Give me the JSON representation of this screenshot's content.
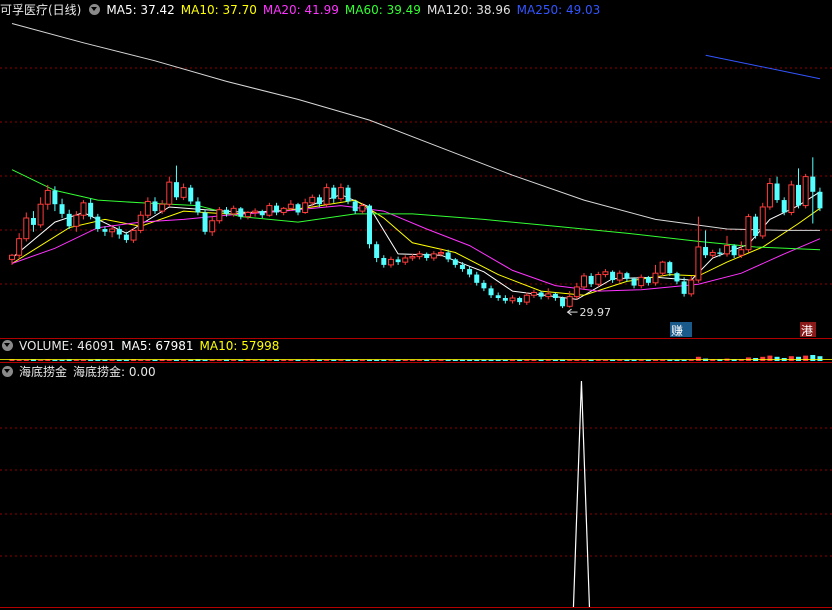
{
  "header": {
    "title": "可孚医疗(日线)",
    "ma": [
      {
        "label": "MA5: 37.42",
        "color": "#ffffff"
      },
      {
        "label": "MA10: 37.70",
        "color": "#ffff00"
      },
      {
        "label": "MA20: 41.99",
        "color": "#ff33ff"
      },
      {
        "label": "MA60: 39.49",
        "color": "#33ff33"
      },
      {
        "label": "MA120: 38.96",
        "color": "#e0e0e0"
      },
      {
        "label": "MA250: 49.03",
        "color": "#3355ff"
      }
    ]
  },
  "volume_panel": {
    "title": "VOLUME: 46091",
    "ma5": "MA5: 67981",
    "ma10": "MA10: 57998"
  },
  "indicator_panel": {
    "title": "海底捞金",
    "value_label": "海底捞金: 0.00"
  },
  "colors": {
    "up": "#ff3c3c",
    "down": "#54ffff",
    "ma5": "#ffffff",
    "ma10": "#ffff00",
    "ma20": "#ff33ff",
    "ma60": "#33ff33",
    "ma120": "#d8d8d8",
    "ma250": "#3355ff",
    "grid": "#8b0000"
  },
  "chart_data": {
    "type": "candlestick",
    "y_range": [
      27.8,
      51.0
    ],
    "low_annotation": "29.97",
    "signal_labels": [
      "赚",
      "港"
    ],
    "candles": [
      [
        33.5,
        33.8,
        33.1,
        33.9
      ],
      [
        33.8,
        35.0,
        33.5,
        35.4
      ],
      [
        35.0,
        36.5,
        34.8,
        36.9
      ],
      [
        36.5,
        36.0,
        35.5,
        37.0
      ],
      [
        36.0,
        37.5,
        35.8,
        38.0
      ],
      [
        37.5,
        38.5,
        37.1,
        38.9
      ],
      [
        38.5,
        37.5,
        37.0,
        38.8
      ],
      [
        37.5,
        36.8,
        36.5,
        37.9
      ],
      [
        36.8,
        35.9,
        35.7,
        37.1
      ],
      [
        35.9,
        36.7,
        35.5,
        37.0
      ],
      [
        36.7,
        37.6,
        36.4,
        37.8
      ],
      [
        37.6,
        36.6,
        36.4,
        37.9
      ],
      [
        36.6,
        35.7,
        35.5,
        36.8
      ],
      [
        35.7,
        35.5,
        35.2,
        35.9
      ],
      [
        35.5,
        35.7,
        35.1,
        36.0
      ],
      [
        35.7,
        35.3,
        35.0,
        35.9
      ],
      [
        35.3,
        34.9,
        34.7,
        35.5
      ],
      [
        34.9,
        35.6,
        34.7,
        35.8
      ],
      [
        35.6,
        36.7,
        35.4,
        37.0
      ],
      [
        36.7,
        37.7,
        36.5,
        38.0
      ],
      [
        37.7,
        37.0,
        36.8,
        38.0
      ],
      [
        37.0,
        37.5,
        36.8,
        37.8
      ],
      [
        37.5,
        39.1,
        37.3,
        39.5
      ],
      [
        39.1,
        38.0,
        37.8,
        40.3
      ],
      [
        38.0,
        38.7,
        37.8,
        39.0
      ],
      [
        38.7,
        37.7,
        37.5,
        38.9
      ],
      [
        37.7,
        36.9,
        36.7,
        38.0
      ],
      [
        36.9,
        35.5,
        35.3,
        37.1
      ],
      [
        35.5,
        36.3,
        35.2,
        36.6
      ],
      [
        36.3,
        37.1,
        36.1,
        37.3
      ],
      [
        37.1,
        36.8,
        36.6,
        37.3
      ],
      [
        36.8,
        37.2,
        36.6,
        37.4
      ],
      [
        37.2,
        36.6,
        36.4,
        37.3
      ],
      [
        36.6,
        36.9,
        36.4,
        37.0
      ],
      [
        36.9,
        37.0,
        36.6,
        37.2
      ],
      [
        37.0,
        36.7,
        36.5,
        37.1
      ],
      [
        36.7,
        37.4,
        36.6,
        37.6
      ],
      [
        37.4,
        36.9,
        36.7,
        37.6
      ],
      [
        36.9,
        37.2,
        36.7,
        37.3
      ],
      [
        37.2,
        37.5,
        37.0,
        37.8
      ],
      [
        37.5,
        36.9,
        36.7,
        37.6
      ],
      [
        36.9,
        37.6,
        36.8,
        37.9
      ],
      [
        37.6,
        38.0,
        37.3,
        38.2
      ],
      [
        38.0,
        37.5,
        37.3,
        38.2
      ],
      [
        37.5,
        38.7,
        37.3,
        39.0
      ],
      [
        38.7,
        37.9,
        37.6,
        38.9
      ],
      [
        37.9,
        38.7,
        37.7,
        39.0
      ],
      [
        38.7,
        37.7,
        37.5,
        38.9
      ],
      [
        37.7,
        37.0,
        36.8,
        37.8
      ],
      [
        37.0,
        37.4,
        36.8,
        37.6
      ],
      [
        37.4,
        34.6,
        34.3,
        37.5
      ],
      [
        34.6,
        33.6,
        33.3,
        34.8
      ],
      [
        33.6,
        33.1,
        32.9,
        33.8
      ],
      [
        33.1,
        33.5,
        32.9,
        33.7
      ],
      [
        33.5,
        33.3,
        33.1,
        33.7
      ],
      [
        33.3,
        33.6,
        33.1,
        33.8
      ],
      [
        33.6,
        33.7,
        33.4,
        33.9
      ],
      [
        33.7,
        33.9,
        33.5,
        34.1
      ],
      [
        33.9,
        33.6,
        33.4,
        34.0
      ],
      [
        33.6,
        33.9,
        33.4,
        34.1
      ],
      [
        33.9,
        34.0,
        33.7,
        34.3
      ],
      [
        34.0,
        33.5,
        33.3,
        34.2
      ],
      [
        33.5,
        33.1,
        32.9,
        33.6
      ],
      [
        33.1,
        32.8,
        32.6,
        33.3
      ],
      [
        32.8,
        32.4,
        32.2,
        33.0
      ],
      [
        32.4,
        31.8,
        31.6,
        32.6
      ],
      [
        31.8,
        31.4,
        31.2,
        32.0
      ],
      [
        31.4,
        30.9,
        30.7,
        31.6
      ],
      [
        30.9,
        30.7,
        30.5,
        31.1
      ],
      [
        30.7,
        30.5,
        30.3,
        30.9
      ],
      [
        30.5,
        30.7,
        30.3,
        30.9
      ],
      [
        30.7,
        30.4,
        30.2,
        30.8
      ],
      [
        30.4,
        30.9,
        30.2,
        31.1
      ],
      [
        30.9,
        31.1,
        30.7,
        31.3
      ],
      [
        31.1,
        30.8,
        30.6,
        31.2
      ],
      [
        30.8,
        31.0,
        30.6,
        31.4
      ],
      [
        31.0,
        30.7,
        30.5,
        31.1
      ],
      [
        30.7,
        30.1,
        29.97,
        30.8
      ],
      [
        30.1,
        30.8,
        30.0,
        31.2
      ],
      [
        30.8,
        31.5,
        30.6,
        31.8
      ],
      [
        31.5,
        32.3,
        31.3,
        32.5
      ],
      [
        32.3,
        31.7,
        31.5,
        32.5
      ],
      [
        31.7,
        32.4,
        31.5,
        32.6
      ],
      [
        32.4,
        32.6,
        32.2,
        32.8
      ],
      [
        32.6,
        32.0,
        31.8,
        32.7
      ],
      [
        32.0,
        32.5,
        31.8,
        32.7
      ],
      [
        32.5,
        32.1,
        31.9,
        32.6
      ],
      [
        32.1,
        31.6,
        31.4,
        32.2
      ],
      [
        31.6,
        32.2,
        31.4,
        32.4
      ],
      [
        32.2,
        31.8,
        31.6,
        32.3
      ],
      [
        31.8,
        32.5,
        31.6,
        33.1
      ],
      [
        32.5,
        33.3,
        32.3,
        33.4
      ],
      [
        33.3,
        32.5,
        32.3,
        33.4
      ],
      [
        32.5,
        31.9,
        31.7,
        32.6
      ],
      [
        31.9,
        31.0,
        30.8,
        32.2
      ],
      [
        31.0,
        32.0,
        30.8,
        32.3
      ],
      [
        32.0,
        34.4,
        31.8,
        36.6
      ],
      [
        34.4,
        33.8,
        33.6,
        35.6
      ],
      [
        33.8,
        34.0,
        33.6,
        34.2
      ],
      [
        34.0,
        33.9,
        33.7,
        34.3
      ],
      [
        33.9,
        34.5,
        33.7,
        35.2
      ],
      [
        34.5,
        33.8,
        33.6,
        34.6
      ],
      [
        33.8,
        34.2,
        33.6,
        34.8
      ],
      [
        34.2,
        36.6,
        34.0,
        36.8
      ],
      [
        36.6,
        35.2,
        35.0,
        36.8
      ],
      [
        35.2,
        37.3,
        35.0,
        37.6
      ],
      [
        37.3,
        39.0,
        37.1,
        39.4
      ],
      [
        39.0,
        37.8,
        37.6,
        39.5
      ],
      [
        37.8,
        36.9,
        36.7,
        38.0
      ],
      [
        36.9,
        38.9,
        36.7,
        39.2
      ],
      [
        38.9,
        37.4,
        37.2,
        40.1
      ],
      [
        37.4,
        39.5,
        37.2,
        39.7
      ],
      [
        39.5,
        38.4,
        36.1,
        40.9
      ],
      [
        38.4,
        37.2,
        37.0,
        38.7
      ]
    ],
    "ma_series": [
      {
        "key": "ma5",
        "values": [
          [
            0,
            33.6
          ],
          [
            6,
            36.2
          ],
          [
            10,
            36.9
          ],
          [
            16,
            35.4
          ],
          [
            22,
            37.3
          ],
          [
            27,
            37.1
          ],
          [
            33,
            36.9
          ],
          [
            40,
            37.1
          ],
          [
            46,
            38.2
          ],
          [
            50,
            37.3
          ],
          [
            54,
            33.9
          ],
          [
            60,
            33.8
          ],
          [
            66,
            32.6
          ],
          [
            70,
            31.2
          ],
          [
            76,
            30.8
          ],
          [
            79,
            30.6
          ],
          [
            84,
            32.1
          ],
          [
            90,
            32.2
          ],
          [
            95,
            32.0
          ],
          [
            98,
            33.6
          ],
          [
            103,
            34.6
          ],
          [
            106,
            36.4
          ],
          [
            110,
            37.4
          ],
          [
            113,
            38.4
          ]
        ]
      },
      {
        "key": "ma10",
        "values": [
          [
            0,
            33.2
          ],
          [
            8,
            35.8
          ],
          [
            13,
            36.4
          ],
          [
            18,
            35.9
          ],
          [
            24,
            37.0
          ],
          [
            30,
            36.8
          ],
          [
            36,
            36.9
          ],
          [
            42,
            37.3
          ],
          [
            48,
            37.8
          ],
          [
            52,
            36.5
          ],
          [
            56,
            34.7
          ],
          [
            62,
            34.0
          ],
          [
            68,
            32.4
          ],
          [
            74,
            31.2
          ],
          [
            80,
            30.9
          ],
          [
            86,
            31.9
          ],
          [
            92,
            32.4
          ],
          [
            96,
            32.3
          ],
          [
            100,
            33.3
          ],
          [
            105,
            34.4
          ],
          [
            110,
            36.1
          ],
          [
            113,
            37.2
          ]
        ]
      },
      {
        "key": "ma20",
        "values": [
          [
            0,
            33.2
          ],
          [
            6,
            34.3
          ],
          [
            12,
            35.8
          ],
          [
            18,
            36.2
          ],
          [
            24,
            36.4
          ],
          [
            30,
            36.7
          ],
          [
            38,
            37.0
          ],
          [
            46,
            37.4
          ],
          [
            52,
            37.0
          ],
          [
            58,
            35.7
          ],
          [
            64,
            34.5
          ],
          [
            70,
            32.7
          ],
          [
            76,
            31.6
          ],
          [
            82,
            31.2
          ],
          [
            88,
            31.3
          ],
          [
            96,
            31.7
          ],
          [
            102,
            32.5
          ],
          [
            108,
            33.9
          ],
          [
            113,
            35.0
          ]
        ]
      },
      {
        "key": "ma60",
        "values": [
          [
            0,
            40.0
          ],
          [
            6,
            38.5
          ],
          [
            12,
            37.8
          ],
          [
            18,
            37.6
          ],
          [
            26,
            37.4
          ],
          [
            32,
            36.6
          ],
          [
            40,
            36.2
          ],
          [
            48,
            36.8
          ],
          [
            56,
            36.8
          ],
          [
            66,
            36.4
          ],
          [
            76,
            35.9
          ],
          [
            86,
            35.4
          ],
          [
            96,
            34.8
          ],
          [
            104,
            34.4
          ],
          [
            113,
            34.2
          ]
        ]
      },
      {
        "key": "ma120",
        "values": [
          [
            0,
            50.6
          ],
          [
            10,
            49.2
          ],
          [
            20,
            47.9
          ],
          [
            30,
            46.4
          ],
          [
            40,
            45.1
          ],
          [
            50,
            43.6
          ],
          [
            60,
            41.6
          ],
          [
            70,
            39.6
          ],
          [
            80,
            37.8
          ],
          [
            90,
            36.4
          ],
          [
            100,
            35.7
          ],
          [
            108,
            35.6
          ],
          [
            113,
            35.6
          ]
        ]
      },
      {
        "key": "ma250",
        "values": [
          [
            97,
            48.3
          ],
          [
            113,
            46.6
          ]
        ]
      }
    ],
    "volume": [
      0.3,
      0.2,
      0.2,
      0.3,
      0.2,
      0.3,
      0.2,
      0.2,
      0.3,
      0.2,
      0.2,
      0.2,
      0.3,
      0.2,
      0.2,
      0.2,
      0.2,
      0.3,
      0.2,
      0.2,
      0.2,
      0.3,
      0.2,
      0.2,
      0.2,
      0.2,
      0.3,
      0.2,
      0.2,
      0.2,
      0.2,
      0.2,
      0.2,
      0.3,
      0.2,
      0.2,
      0.2,
      0.2,
      0.2,
      0.2,
      0.2,
      0.2,
      0.3,
      0.2,
      0.2,
      0.2,
      0.2,
      0.2,
      0.2,
      0.2,
      0.2,
      0.2,
      0.2,
      0.2,
      0.2,
      0.2,
      0.2,
      0.2,
      0.2,
      0.2,
      0.2,
      0.2,
      0.2,
      0.2,
      0.2,
      0.2,
      0.2,
      0.2,
      0.2,
      0.2,
      0.2,
      0.2,
      0.2,
      0.2,
      0.2,
      0.2,
      0.2,
      0.2,
      0.2,
      0.2,
      0.2,
      0.2,
      0.2,
      0.2,
      0.2,
      0.2,
      0.2,
      0.2,
      0.2,
      0.2,
      0.2,
      0.2,
      0.2,
      0.2,
      0.2,
      0.2,
      0.7,
      0.4,
      0.3,
      0.3,
      0.4,
      0.3,
      0.3,
      0.6,
      0.5,
      0.7,
      0.9,
      0.7,
      0.5,
      0.8,
      0.7,
      0.9,
      1.0,
      0.8
    ],
    "indicator": {
      "signal_index": 83,
      "signal_value": 1,
      "y_range": [
        0,
        1
      ]
    }
  }
}
